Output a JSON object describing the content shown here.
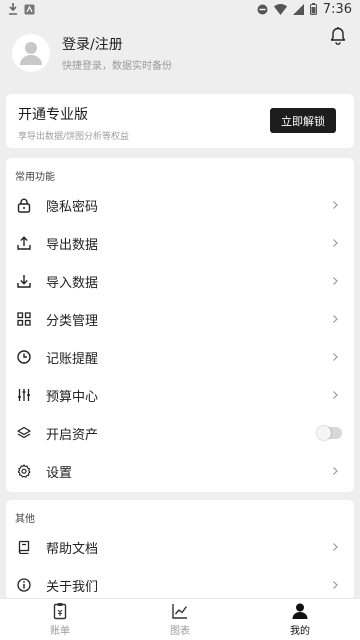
{
  "status_bar": {
    "time": "7:36"
  },
  "profile": {
    "title": "登录/注册",
    "subtitle": "快捷登录，数据实时备份"
  },
  "pro": {
    "title": "开通专业版",
    "subtitle": "享导出数据/饼图分析等权益",
    "button": "立即解锁"
  },
  "features": {
    "title": "常用功能",
    "items": [
      {
        "label": "隐私密码",
        "icon": "lock-icon"
      },
      {
        "label": "导出数据",
        "icon": "upload-icon"
      },
      {
        "label": "导入数据",
        "icon": "download-icon"
      },
      {
        "label": "分类管理",
        "icon": "grid-icon"
      },
      {
        "label": "记账提醒",
        "icon": "clock-icon"
      },
      {
        "label": "预算中心",
        "icon": "sliders-icon"
      },
      {
        "label": "开启资产",
        "icon": "layers-icon",
        "toggle": false
      },
      {
        "label": "设置",
        "icon": "gear-icon"
      }
    ]
  },
  "others": {
    "title": "其他",
    "items": [
      {
        "label": "帮助文档",
        "icon": "book-icon"
      },
      {
        "label": "关于我们",
        "icon": "info-icon"
      }
    ]
  },
  "tabbar": {
    "tabs": [
      {
        "label": "账单",
        "icon": "bill-icon",
        "active": false
      },
      {
        "label": "图表",
        "icon": "chart-icon",
        "active": false
      },
      {
        "label": "我的",
        "icon": "person-icon",
        "active": true
      }
    ]
  }
}
